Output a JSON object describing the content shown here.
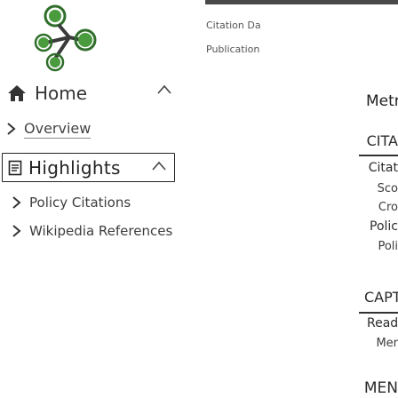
{
  "nav": {
    "home": {
      "label": "Home",
      "icon": "home-icon",
      "expanded": true
    },
    "overview": {
      "label": "Overview",
      "icon": "chevron-right-icon"
    },
    "highlights": {
      "label": "Highlights",
      "icon": "document-icon",
      "expanded": true,
      "selected": true
    },
    "sub_items": [
      {
        "label": "Policy Citations",
        "icon": "chevron-right-icon"
      },
      {
        "label": "Wikipedia References",
        "icon": "chevron-right-icon"
      }
    ]
  },
  "panel": {
    "citation_label": "Citation Da",
    "publication_label": "Publication",
    "metrics_heading": "Metr",
    "citations_section": {
      "heading": "CITA",
      "subheading": "Citat",
      "items": [
        "Sco",
        "Cro"
      ],
      "policy_heading": "Polic",
      "policy_item": "Poli"
    },
    "captures_section": {
      "heading": "CAPT",
      "subheading": "Read",
      "item": "Mer"
    },
    "mentions_heading": "MEN"
  },
  "colors": {
    "logo_green": "#4a9a3e",
    "logo_green_dark": "#2f6e2a",
    "text": "#333333",
    "border": "#222222"
  }
}
